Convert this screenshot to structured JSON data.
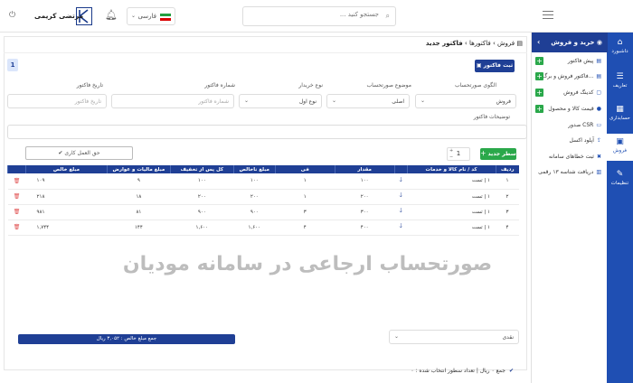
{
  "header": {
    "search_placeholder": "جستجو کنید ...",
    "language": "فارسی",
    "user_name": "مرتضی کریمی"
  },
  "iconbar": [
    {
      "label": "داشبورد",
      "icon": "home-icon"
    },
    {
      "label": "تعاریف",
      "icon": "list-icon"
    },
    {
      "label": "حسابداری",
      "icon": "calculator-icon"
    },
    {
      "label": "فروش",
      "icon": "cart-icon"
    },
    {
      "label": "تنظیمات",
      "icon": "gear-icon"
    }
  ],
  "subnav": {
    "title": "خرید و فروش",
    "items": [
      "پیش فاکتور",
      "فاکتور فروش و برگ...",
      "کدینگ فروش",
      "قیمت کالا و محصول",
      "صدور CSR",
      "آپلود اکسل",
      "ثبت خطاهای سامانه",
      "دریافت شناسه ۱۳ رقمی"
    ]
  },
  "breadcrumb": {
    "root": "فروش",
    "sep": "›",
    "parent": "فاکتورها",
    "current": "فاکتور جدید"
  },
  "toolbar": {
    "print_label": "ثبت فاکتور",
    "tab_badge": "1"
  },
  "form": {
    "pattern_label": "الگوی صورتحساب",
    "pattern_value": "فروش",
    "subject_label": "موضوع صورتحساب",
    "subject_value": "اصلی",
    "buyer_type_label": "نوع خریدار",
    "buyer_type_value": "نوع اول",
    "invoice_number_label": "شماره فاکتور",
    "invoice_number_placeholder": "شماره فاکتور",
    "invoice_date_label": "تاریخ فاکتور",
    "invoice_date_placeholder": "تاریخ فاکتور",
    "description_label": "توضیحات فاکتور"
  },
  "rows_toolbar": {
    "add_label": "سطر جدید",
    "count": "1",
    "outline_label": "حق العمل کاری"
  },
  "table": {
    "headers": [
      "ردیف",
      "کد / نام کالا و خدمات",
      "",
      "مقدار",
      "فی",
      "مبلغ ناخالص",
      "کل پس از تخفیف",
      "مبلغ مالیات و عوارض",
      "مبلغ خالص",
      ""
    ],
    "rows": [
      [
        "۱",
        "۱ | تست",
        "۱۰۰",
        "۱",
        "۱۰۰",
        "۱۰۰",
        "۹",
        "۱۰۹"
      ],
      [
        "۲",
        "۱ | تست",
        "۲۰۰",
        "۱",
        "۲۰۰",
        "۲۰۰",
        "۱۸",
        "۲۱۸"
      ],
      [
        "۳",
        "۱ | تست",
        "۳۰۰",
        "۳",
        "۹۰۰",
        "۹۰۰",
        "۸۱",
        "۹۸۱"
      ],
      [
        "۴",
        "۱ | تست",
        "۴۰۰",
        "۴",
        "۱,۶۰۰",
        "۱,۶۰۰",
        "۱۴۴",
        "۱,۷۴۴"
      ]
    ]
  },
  "watermark": "صورتحساب ارجاعی در سامانه مودیان",
  "payment": {
    "value": "نقدی"
  },
  "total_label": "جمع مبلغ خالص : ۳,۰۵۲ ریال",
  "footer": "جمع ۰ ریال | تعداد سطور انتخاب شده : ۰"
}
